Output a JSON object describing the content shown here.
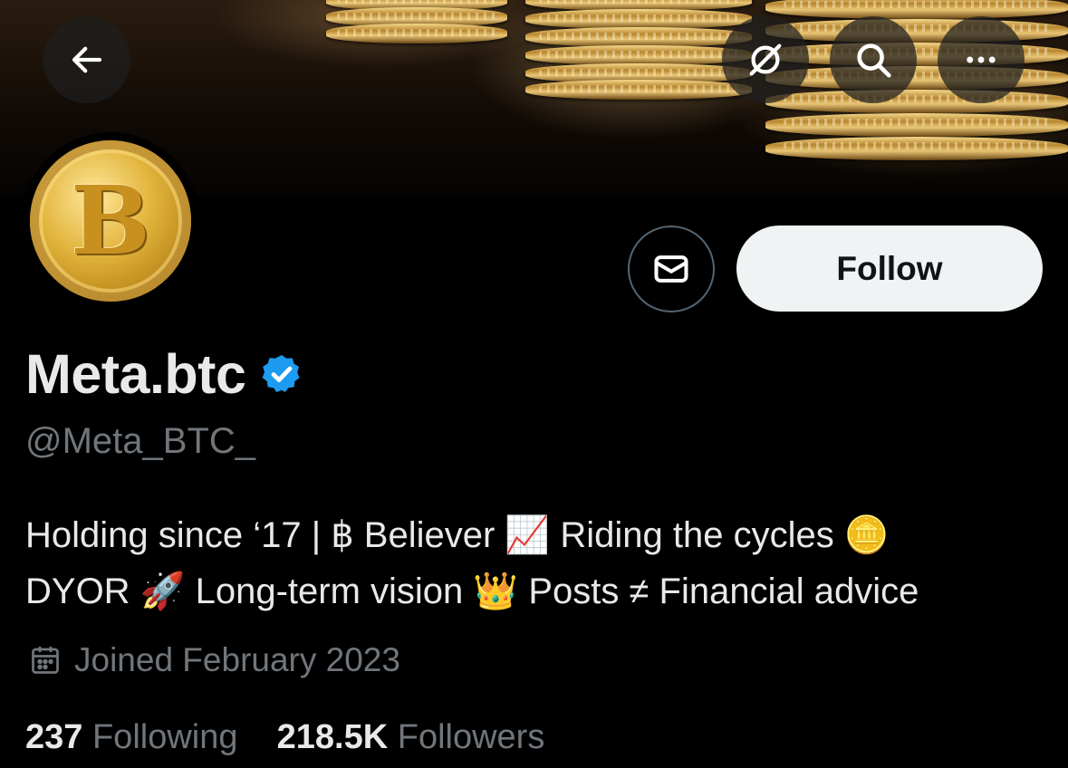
{
  "nav": {
    "back_icon": "arrow-left-icon",
    "grok_icon": "grok-slash-circle-icon",
    "search_icon": "search-icon",
    "more_icon": "more-horizontal-icon"
  },
  "actions": {
    "message_icon": "envelope-icon",
    "follow_label": "Follow"
  },
  "profile": {
    "display_name": "Meta.btc",
    "verified": true,
    "handle": "@Meta_BTC_",
    "bio_line1": "Holding since ‘17 | ฿ Believer 📈 Riding the cycles 🪙",
    "bio_line2": "DYOR 🚀 Long-term vision 👑 Posts ≠ Financial advice",
    "joined": "Joined February 2023",
    "following_count": "237",
    "following_label": "Following",
    "followers_count": "218.5K",
    "followers_label": "Followers"
  },
  "colors": {
    "background": "#000000",
    "primary_text": "#e7e9ea",
    "secondary_text": "#71767b",
    "verified_blue": "#1d9bf0",
    "follow_bg": "#eff3f4"
  }
}
